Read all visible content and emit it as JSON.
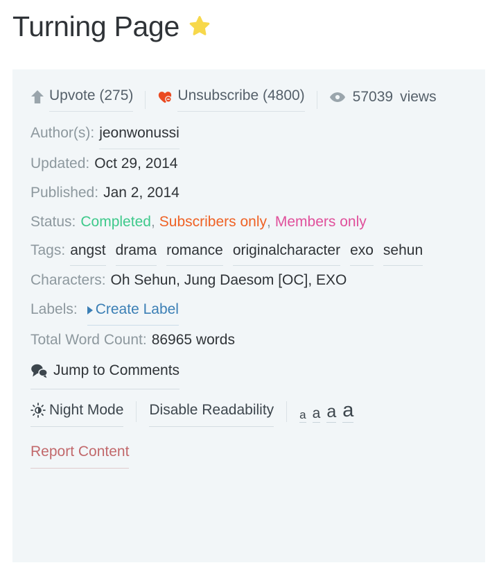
{
  "header": {
    "title": "Turning Page",
    "star_icon": "star-icon",
    "star_color": "#f7d84b"
  },
  "stats": {
    "upvote": {
      "icon": "upvote-arrow-icon",
      "label": "Upvote (275)",
      "count": 275
    },
    "unsubscribe": {
      "icon": "heart-minus-icon",
      "label": "Unsubscribe (4800)",
      "count": 4800,
      "heart_color": "#ea4a21"
    },
    "views": {
      "icon": "eye-icon",
      "count": "57039",
      "suffix": "views"
    }
  },
  "meta": {
    "authors": {
      "label": "Author(s):",
      "value": "jeonwonussi"
    },
    "updated": {
      "label": "Updated:",
      "value": "Oct 29, 2014"
    },
    "published": {
      "label": "Published:",
      "value": "Jan 2, 2014"
    },
    "status": {
      "label": "Status:",
      "items": [
        {
          "text": "Completed",
          "color": "#3ec98b"
        },
        {
          "text": "Subscribers only",
          "color": "#ef6225"
        },
        {
          "text": "Members only",
          "color": "#e0509b"
        }
      ],
      "separator": ","
    },
    "tags": {
      "label": "Tags:",
      "items": [
        "angst",
        "drama",
        "romance",
        "originalcharacter",
        "exo",
        "sehun"
      ]
    },
    "characters": {
      "label": "Characters:",
      "value": "Oh Sehun, Jung Daesom [OC], EXO"
    },
    "labels": {
      "label": "Labels:",
      "create_label": "Create Label",
      "create_label_color": "#3b7fb5",
      "triangle_icon": "triangle-right-icon"
    },
    "word_count": {
      "label": "Total Word Count:",
      "value": "86965 words"
    }
  },
  "comments": {
    "icon": "speech-bubbles-icon",
    "label": "Jump to Comments"
  },
  "toolbar": {
    "night_mode": {
      "icon": "sun-brightness-icon",
      "label": "Night Mode"
    },
    "readability": {
      "label": "Disable Readability"
    },
    "font_sizes": [
      "a",
      "a",
      "a",
      "a"
    ]
  },
  "footer": {
    "report": {
      "label": "Report Content",
      "color": "#c2696c"
    }
  }
}
